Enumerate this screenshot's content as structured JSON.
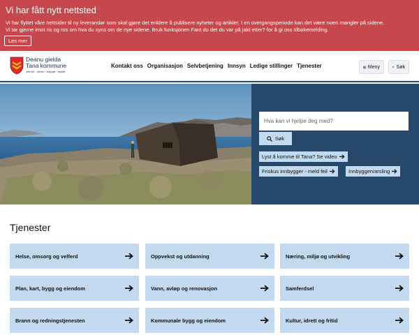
{
  "banner": {
    "title": "Vi har fått nytt nettsted",
    "line1": "Vi har flyttet våre nettsider til ny leverandør som skal gjøre det enklere å publisere nyheter og artikler. I en overgangsperiode kan det være noen mangler på sidene.",
    "line2": "Vi tar gjerne imot ris og ros om hva du syns om de nye sidene. Bruk funksjonen Fant du det du var på jakt etter? for å gi oss tilbakemelding.",
    "button": "Les mer",
    "color": "#c6484c"
  },
  "logo": {
    "line1": "Deanu gielda",
    "line2": "Tana kommune",
    "tagline": "olbmot · ahcen · nappat · ihpidit"
  },
  "nav": [
    "Kontakt oss",
    "Organisasjon",
    "Selvbetjening",
    "Innsyn",
    "Ledige stillinger",
    "Tjenester"
  ],
  "header_buttons": {
    "menu": "Meny",
    "search": "Søk"
  },
  "hero": {
    "search_placeholder": "Hva kan vi hjelpe deg med?",
    "search_button": "Søk",
    "links": [
      "Lyst å komme til Tana? Se video",
      "Friskus innbygger - meld feil",
      "Innbyggervarsling"
    ],
    "panel_color": "#26486a"
  },
  "services": {
    "title": "Tjenester",
    "items": [
      "Helse, omsorg og velferd",
      "Oppvekst og utdanning",
      "Næring, miljø og utvikling",
      "Plan, kart, bygg og eiendom",
      "Vann, avløp og renovasjon",
      "Samferdsel",
      "Brann og redningstjenesten",
      "Kommunale bygg og eiendom",
      "Kultur, idrett og fritid"
    ],
    "card_color": "#c3d9ef"
  }
}
